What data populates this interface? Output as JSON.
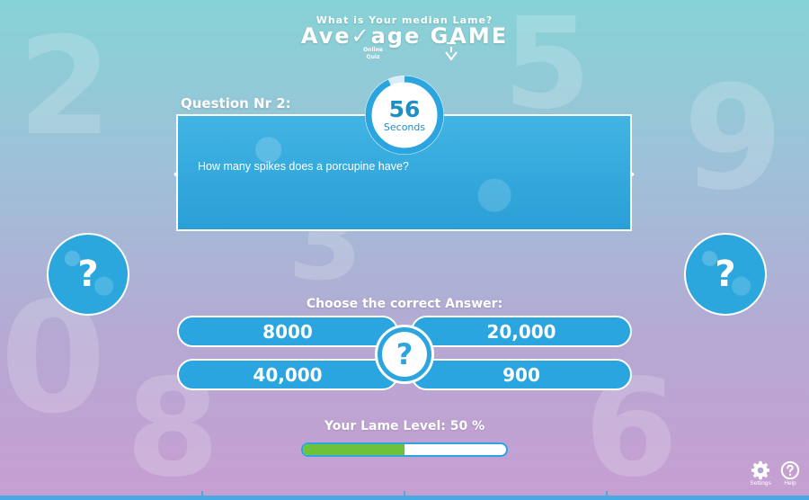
{
  "header": {
    "tagline": "What is Your median Lame?",
    "logo": "Ave✓age GAME",
    "badge_line1": "Online",
    "badge_line2": "Quiz"
  },
  "question": {
    "label": "Question Nr 2:",
    "text": "How many spikes does a porcupine have?",
    "prev_glyph": "‹",
    "next_glyph": "›"
  },
  "timer": {
    "value": "56",
    "unit": "Seconds",
    "fraction_remaining": 0.93
  },
  "lifelines": {
    "left_glyph": "?",
    "right_glyph": "?"
  },
  "answers": {
    "prompt": "Choose the correct Answer:",
    "options": [
      "8000",
      "20,000",
      "40,000",
      "900"
    ],
    "center_glyph": "?"
  },
  "level": {
    "label": "Your Lame Level:",
    "value_text": "50 %",
    "fraction": 0.5
  },
  "tools": {
    "settings_label": "Settings",
    "help_label": "Help"
  },
  "colors": {
    "accent": "#2aa5e0",
    "level_fill": "#6cc23a"
  }
}
